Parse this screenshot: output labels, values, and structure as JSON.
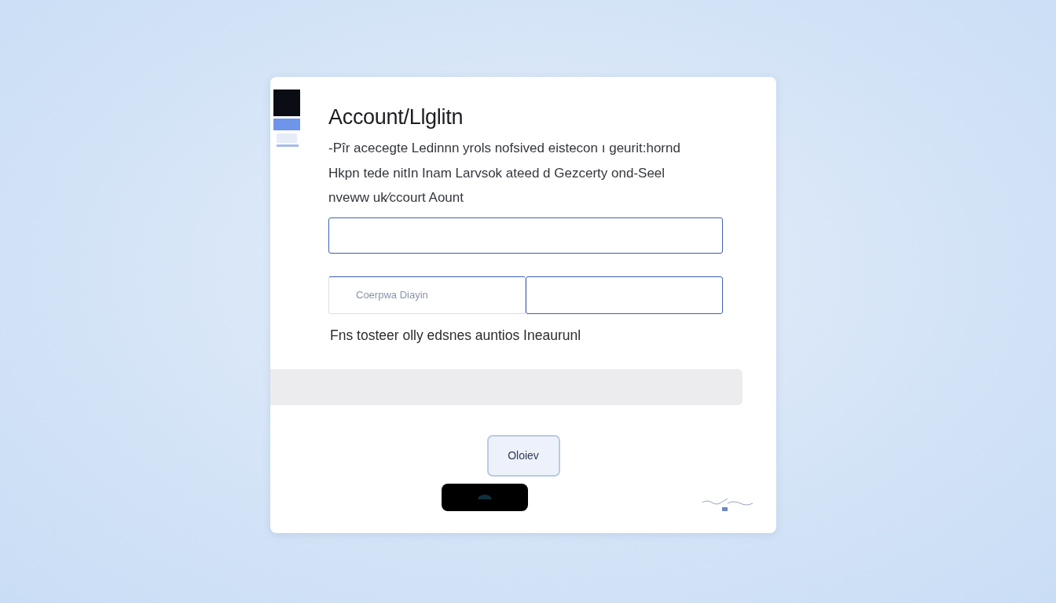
{
  "dialog": {
    "title": "Account/Llglitn",
    "description": [
      "-Pîr acecegte Ledinnn yrols nofsived eistecon ı geurit:hornd",
      "Hkpn tede nitIn Inam Larvsok ateed d Gezcerty ond-Seel",
      "nveww uk⁄ccourt Aount"
    ],
    "fields": [
      {
        "kind": "full"
      },
      {
        "kind": "half",
        "placeholder": "Coerpwa Diayin"
      },
      {
        "kind": "half"
      }
    ],
    "note": "Fns tosteer olly edsnes auntios Ineaurunl",
    "buttons": [
      {
        "kind": "light",
        "label": "Oloiev"
      },
      {
        "kind": "dark"
      }
    ]
  }
}
